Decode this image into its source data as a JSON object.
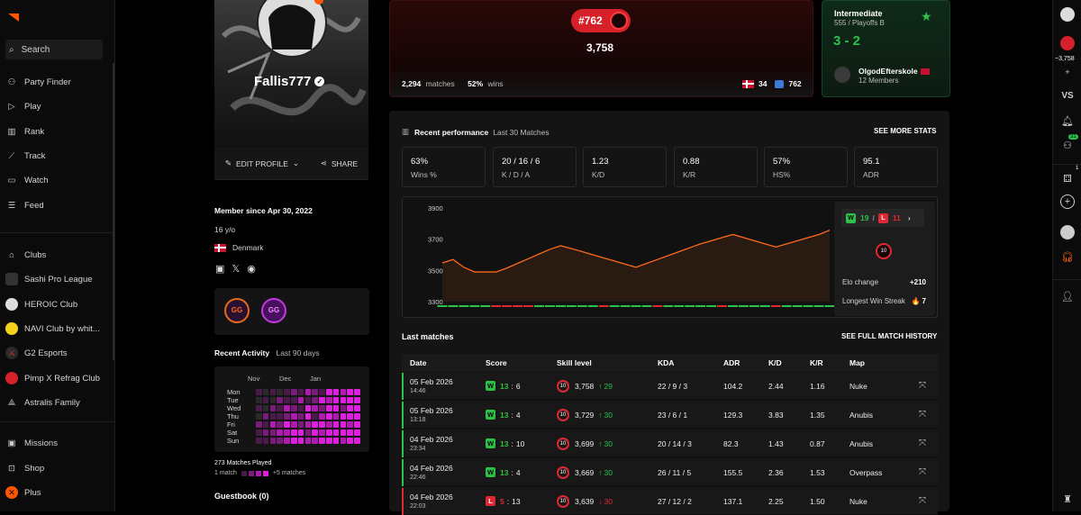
{
  "nav": {
    "search": "Search",
    "items": [
      "Party Finder",
      "Play",
      "Rank",
      "Track",
      "Watch",
      "Feed"
    ],
    "clubs": [
      "Clubs",
      "Sashi Pro League",
      "HEROIC Club",
      "NAVI Club by whit...",
      "G2 Esports",
      "Pimp X Refrag Club",
      "Astralis Family"
    ],
    "bottom": [
      "Missions",
      "Shop",
      "Plus"
    ]
  },
  "profile": {
    "name": "Fallis777",
    "edit": "EDIT PROFILE",
    "share": "SHARE",
    "member_since": "Member since Apr 30, 2022",
    "age": "16 y/o",
    "country": "Denmark",
    "badges": [
      "GG",
      "GG"
    ]
  },
  "activity": {
    "title": "Recent Activity",
    "period": "Last 90 days",
    "months": [
      "Nov",
      "Dec",
      "Jan"
    ],
    "days": [
      "Mon",
      "Tue",
      "Wed",
      "Thu",
      "Fri",
      "Sat",
      "Sun"
    ],
    "matches_played": "273 Matches Played",
    "legend_min": "1 match",
    "legend_max": "+5 matches"
  },
  "guestbook": "Guestbook (0)",
  "elo_card": {
    "elo_badge": "#762",
    "elo": "3,758",
    "matches_val": "2,294",
    "matches_lbl": "matches",
    "wins_val": "52%",
    "wins_lbl": "wins",
    "country_rank": "34",
    "region_rank": "762"
  },
  "club_card": {
    "division": "Intermediate",
    "sub": "555 / Playoffs B",
    "score": "3 - 2",
    "club": "OlgodEfterskole",
    "members": "12 Members"
  },
  "performance": {
    "title": "Recent performance",
    "period": "Last 30 Matches",
    "more": "SEE MORE STATS",
    "stats": [
      {
        "v": "63%",
        "k": "Wins %"
      },
      {
        "v": "20 / 16 / 6",
        "k": "K / D / A"
      },
      {
        "v": "1.23",
        "k": "K/D"
      },
      {
        "v": "0.88",
        "k": "K/R"
      },
      {
        "v": "57%",
        "k": "HS%"
      },
      {
        "v": "95.1",
        "k": "ADR"
      }
    ],
    "wins": "19",
    "losses": "11",
    "elo_change_lbl": "Elo change",
    "elo_change": "+210",
    "streak_lbl": "Longest Win Streak",
    "streak": "7",
    "level": "10"
  },
  "chart_data": {
    "type": "line",
    "ylim": [
      3300,
      3900
    ],
    "yticks": [
      3900,
      3700,
      3500,
      3300
    ],
    "values": [
      3548,
      3570,
      3520,
      3490,
      3490,
      3490,
      3515,
      3545,
      3575,
      3605,
      3635,
      3658,
      3640,
      3620,
      3600,
      3580,
      3560,
      3540,
      3520,
      3545,
      3570,
      3595,
      3620,
      3645,
      3670,
      3690,
      3710,
      3730,
      3710,
      3690,
      3670,
      3650,
      3670,
      3690,
      3710,
      3730,
      3758
    ],
    "results": [
      "W",
      "W",
      "W",
      "W",
      "W",
      "L",
      "L",
      "L",
      "L",
      "W",
      "W",
      "W",
      "W",
      "W",
      "W",
      "L",
      "W",
      "W",
      "W",
      "W",
      "L",
      "W",
      "W",
      "W",
      "W",
      "W",
      "L",
      "W",
      "W",
      "W",
      "W",
      "L",
      "W",
      "W",
      "W",
      "W",
      "W"
    ],
    "colors": {
      "line": "#ff6a1a",
      "win": "#2bc14a",
      "loss": "#e02833"
    }
  },
  "matches": {
    "title": "Last matches",
    "more": "SEE FULL MATCH HISTORY",
    "headers": [
      "Date",
      "Score",
      "Skill level",
      "KDA",
      "ADR",
      "K/D",
      "K/R",
      "Map"
    ],
    "rows": [
      {
        "date": "05 Feb 2026",
        "time": "14:46",
        "res": "W",
        "score_a": "13",
        "score_b": "6",
        "level": "10",
        "elo": "3,758",
        "delta": "29",
        "dir": "up",
        "kda": "22 / 9 / 3",
        "adr": "104.2",
        "kd": "2.44",
        "kr": "1.16",
        "map": "Nuke"
      },
      {
        "date": "05 Feb 2026",
        "time": "13:18",
        "res": "W",
        "score_a": "13",
        "score_b": "4",
        "level": "10",
        "elo": "3,729",
        "delta": "30",
        "dir": "up",
        "kda": "23 / 6 / 1",
        "adr": "129.3",
        "kd": "3.83",
        "kr": "1.35",
        "map": "Anubis"
      },
      {
        "date": "04 Feb 2026",
        "time": "23:34",
        "res": "W",
        "score_a": "13",
        "score_b": "10",
        "level": "10",
        "elo": "3,699",
        "delta": "30",
        "dir": "up",
        "kda": "20 / 14 / 3",
        "adr": "82.3",
        "kd": "1.43",
        "kr": "0.87",
        "map": "Anubis"
      },
      {
        "date": "04 Feb 2026",
        "time": "22:46",
        "res": "W",
        "score_a": "13",
        "score_b": "4",
        "level": "10",
        "elo": "3,669",
        "delta": "30",
        "dir": "up",
        "kda": "26 / 11 / 5",
        "adr": "155.5",
        "kd": "2.36",
        "kr": "1.53",
        "map": "Overpass"
      },
      {
        "date": "04 Feb 2026",
        "time": "22:03",
        "res": "L",
        "score_a": "5",
        "score_b": "13",
        "level": "10",
        "elo": "3,639",
        "delta": "30",
        "dir": "dn",
        "kda": "27 / 12 / 2",
        "adr": "137.1",
        "kd": "2.25",
        "kr": "1.50",
        "map": "Nuke"
      }
    ]
  },
  "right": {
    "elo": "~3,758",
    "vs": "VS",
    "friends": "31",
    "notif": "1"
  }
}
